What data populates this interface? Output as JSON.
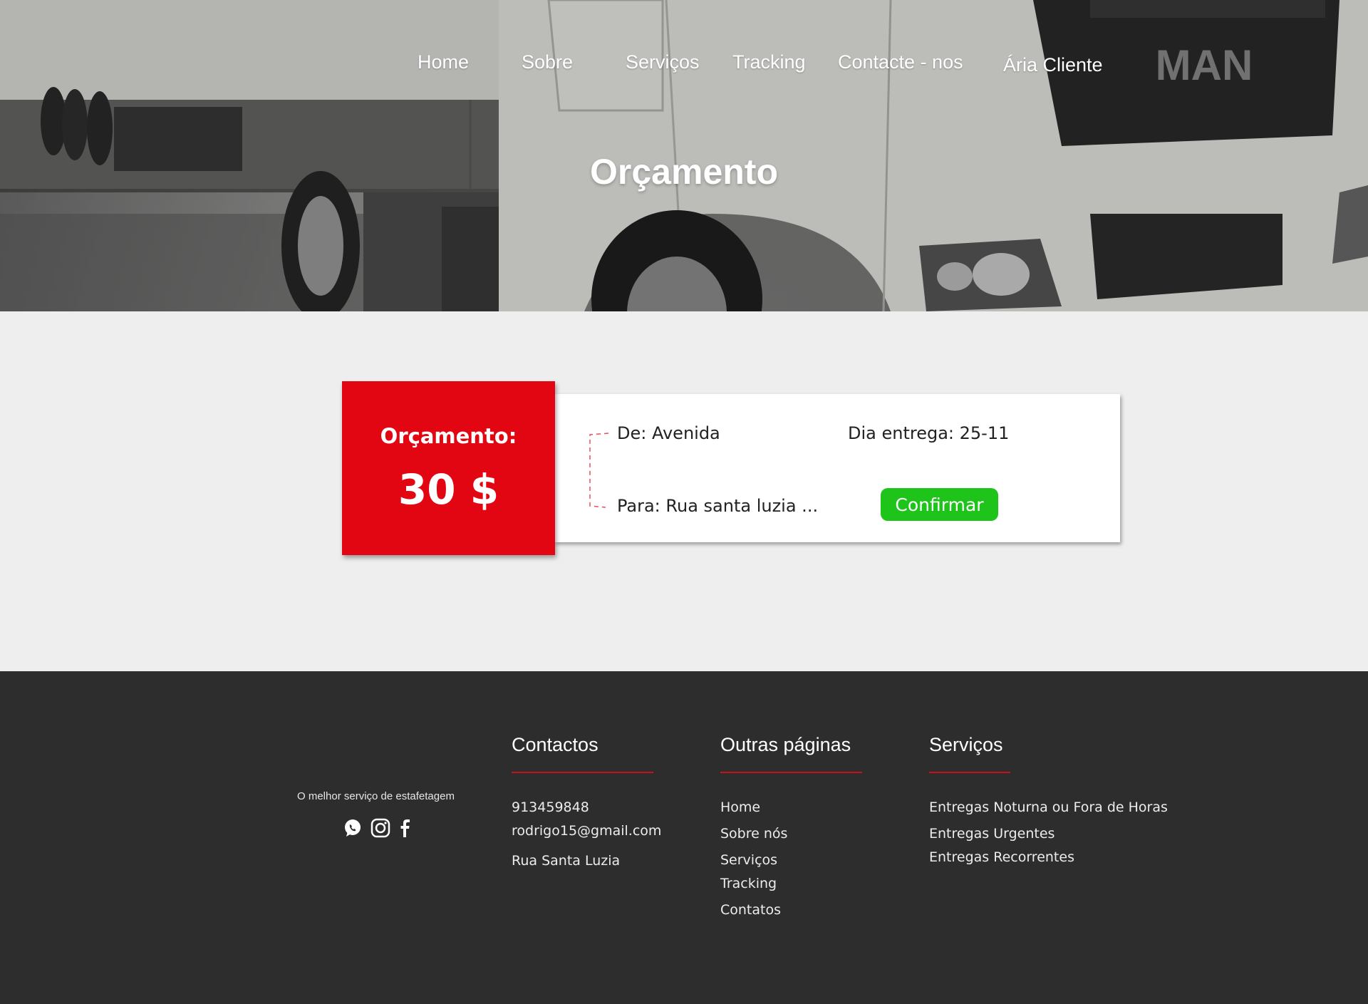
{
  "nav": {
    "items": [
      "Home",
      "Sobre",
      "Serviços",
      "Tracking",
      "Contacte - nos",
      "Ária Cliente"
    ]
  },
  "hero": {
    "title": "Orçamento",
    "truck_badge": "MAN"
  },
  "quote": {
    "label": "Orçamento:",
    "value": "30 $",
    "from": "De: Avenida",
    "to": "Para: Rua santa luzia ...",
    "delivery": "Dia entrega: 25-11",
    "confirm_label": "Confirmar"
  },
  "footer": {
    "tagline": "O melhor serviço de estafetagem",
    "social_icons": [
      "whatsapp-icon",
      "instagram-icon",
      "facebook-icon"
    ],
    "contacts": {
      "title": "Contactos",
      "phone": "913459848",
      "email": "rodrigo15@gmail.com",
      "address": "Rua Santa Luzia"
    },
    "pages": {
      "title": "Outras páginas",
      "items": [
        "Home",
        "Sobre nós",
        "Serviços",
        "Tracking",
        "Contatos"
      ]
    },
    "services": {
      "title": "Serviços",
      "items": [
        "Entregas Noturna ou Fora de Horas",
        "Entregas Urgentes",
        "Entregas Recorrentes"
      ]
    }
  },
  "colors": {
    "accent_red": "#e20613",
    "confirm_green": "#1ec41a",
    "footer_bg": "#2d2d2d",
    "page_bg": "#eeeeee"
  }
}
